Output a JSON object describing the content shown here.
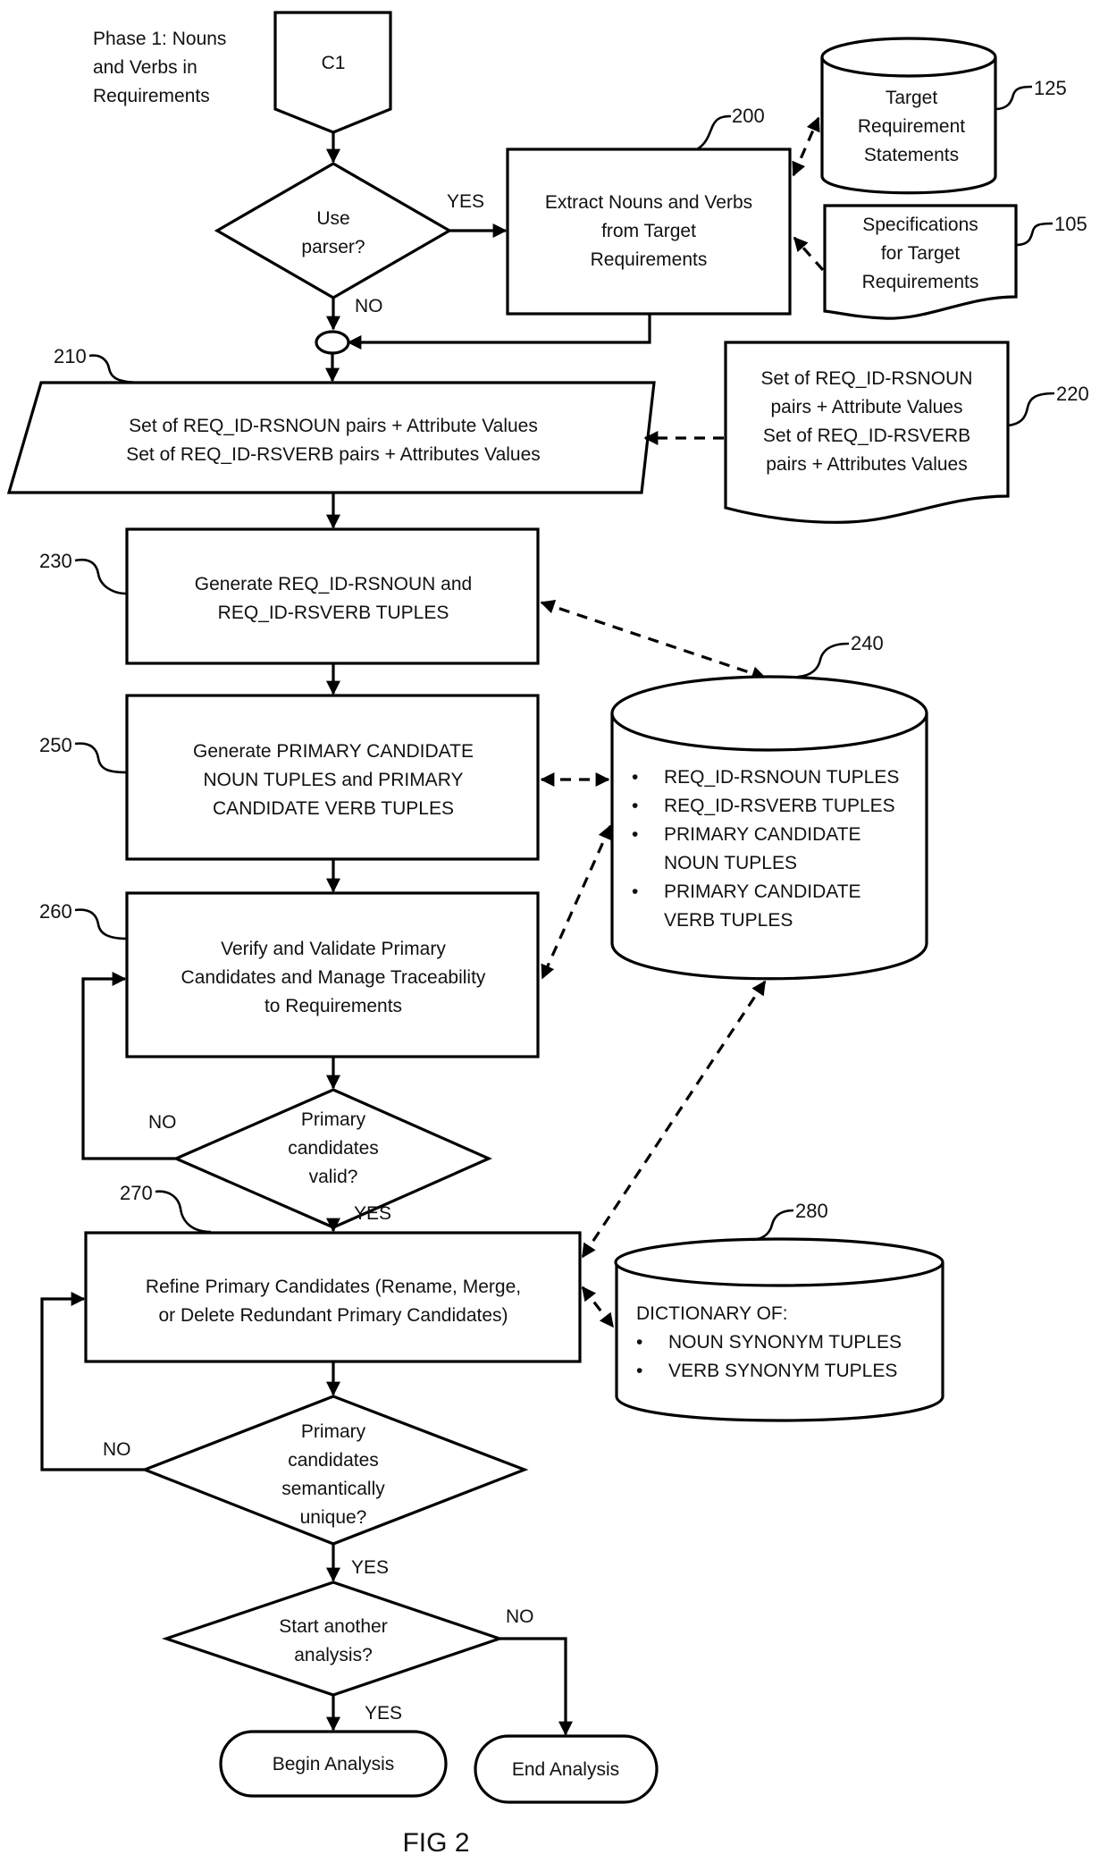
{
  "figure": {
    "caption": "FIG 2",
    "phase_label": [
      "Phase 1: Nouns",
      "and Verbs in",
      "Requirements"
    ],
    "connector_start": "C1",
    "decision_use_parser": {
      "lines": [
        "Use",
        "parser?"
      ],
      "yes": "YES",
      "no": "NO"
    },
    "step_200": {
      "ref": "200",
      "lines": [
        "Extract Nouns and Verbs",
        "from Target",
        "Requirements"
      ]
    },
    "store_125": {
      "ref": "125",
      "lines": [
        "Target",
        "Requirement",
        "Statements"
      ]
    },
    "doc_105": {
      "ref": "105",
      "lines": [
        "Specifications",
        "for Target",
        "Requirements"
      ]
    },
    "io_210": {
      "ref": "210",
      "lines": [
        "Set of REQ_ID-RSNOUN pairs + Attribute Values",
        "Set of REQ_ID-RSVERB pairs + Attributes Values"
      ]
    },
    "doc_220": {
      "ref": "220",
      "lines": [
        "Set of REQ_ID-RSNOUN",
        "pairs + Attribute Values",
        "Set of REQ_ID-RSVERB",
        "pairs + Attributes Values"
      ]
    },
    "step_230": {
      "ref": "230",
      "lines": [
        "Generate REQ_ID-RSNOUN and",
        "REQ_ID-RSVERB TUPLES"
      ]
    },
    "store_240": {
      "ref": "240",
      "items": [
        [
          "REQ_ID-RSNOUN TUPLES"
        ],
        [
          "REQ_ID-RSVERB TUPLES"
        ],
        [
          "PRIMARY CANDIDATE",
          "NOUN TUPLES"
        ],
        [
          "PRIMARY CANDIDATE",
          "VERB TUPLES"
        ]
      ]
    },
    "step_250": {
      "ref": "250",
      "lines": [
        "Generate PRIMARY CANDIDATE",
        "NOUN TUPLES and PRIMARY",
        "CANDIDATE VERB TUPLES"
      ]
    },
    "step_260": {
      "ref": "260",
      "lines": [
        "Verify and Validate Primary",
        "Candidates and Manage Traceability",
        "to  Requirements"
      ]
    },
    "decision_valid": {
      "lines": [
        "Primary",
        "candidates",
        "valid?"
      ],
      "yes": "YES",
      "no": "NO"
    },
    "step_270": {
      "ref": "270",
      "lines": [
        "Refine Primary Candidates  (Rename, Merge,",
        "or Delete Redundant Primary Candidates)"
      ]
    },
    "store_280": {
      "ref": "280",
      "title": "DICTIONARY OF:",
      "items": [
        "NOUN SYNONYM TUPLES",
        "VERB SYNONYM TUPLES"
      ]
    },
    "decision_unique": {
      "lines": [
        "Primary",
        "candidates",
        "semantically",
        "unique?"
      ],
      "yes": "YES",
      "no": "NO"
    },
    "decision_another": {
      "lines": [
        "Start another",
        "analysis?"
      ],
      "yes": "YES",
      "no": "NO"
    },
    "terminal_begin": "Begin  Analysis",
    "terminal_end": "End Analysis",
    "bullet": "•"
  }
}
